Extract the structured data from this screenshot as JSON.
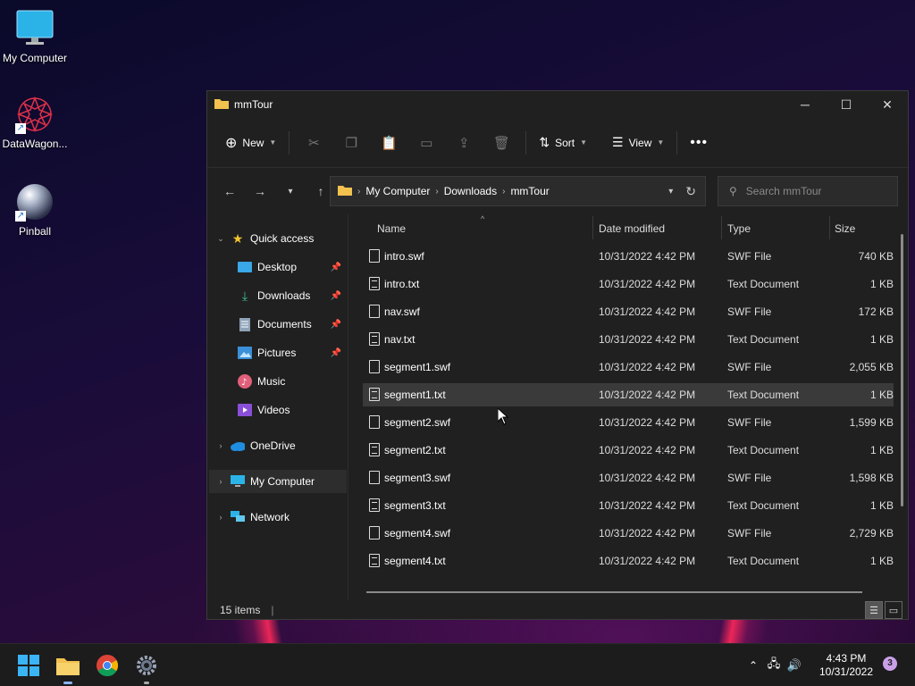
{
  "desktop": {
    "icons": [
      {
        "label": "My Computer"
      },
      {
        "label": "DataWagon..."
      },
      {
        "label": "Pinball"
      }
    ]
  },
  "window": {
    "title": "mmTour",
    "toolbar": {
      "new_label": "New",
      "sort_label": "Sort",
      "view_label": "View"
    },
    "breadcrumb": [
      "My Computer",
      "Downloads",
      "mmTour"
    ],
    "search_placeholder": "Search mmTour",
    "sidebar": {
      "quick_access": "Quick access",
      "items": [
        {
          "label": "Desktop"
        },
        {
          "label": "Downloads"
        },
        {
          "label": "Documents"
        },
        {
          "label": "Pictures"
        },
        {
          "label": "Music"
        },
        {
          "label": "Videos"
        }
      ],
      "onedrive": "OneDrive",
      "my_computer": "My Computer",
      "network": "Network"
    },
    "columns": {
      "name": "Name",
      "date": "Date modified",
      "type": "Type",
      "size": "Size"
    },
    "files": [
      {
        "name": "intro.swf",
        "date": "10/31/2022 4:42 PM",
        "type": "SWF File",
        "size": "740 KB"
      },
      {
        "name": "intro.txt",
        "date": "10/31/2022 4:42 PM",
        "type": "Text Document",
        "size": "1 KB"
      },
      {
        "name": "nav.swf",
        "date": "10/31/2022 4:42 PM",
        "type": "SWF File",
        "size": "172 KB"
      },
      {
        "name": "nav.txt",
        "date": "10/31/2022 4:42 PM",
        "type": "Text Document",
        "size": "1 KB"
      },
      {
        "name": "segment1.swf",
        "date": "10/31/2022 4:42 PM",
        "type": "SWF File",
        "size": "2,055 KB"
      },
      {
        "name": "segment1.txt",
        "date": "10/31/2022 4:42 PM",
        "type": "Text Document",
        "size": "1 KB"
      },
      {
        "name": "segment2.swf",
        "date": "10/31/2022 4:42 PM",
        "type": "SWF File",
        "size": "1,599 KB"
      },
      {
        "name": "segment2.txt",
        "date": "10/31/2022 4:42 PM",
        "type": "Text Document",
        "size": "1 KB"
      },
      {
        "name": "segment3.swf",
        "date": "10/31/2022 4:42 PM",
        "type": "SWF File",
        "size": "1,598 KB"
      },
      {
        "name": "segment3.txt",
        "date": "10/31/2022 4:42 PM",
        "type": "Text Document",
        "size": "1 KB"
      },
      {
        "name": "segment4.swf",
        "date": "10/31/2022 4:42 PM",
        "type": "SWF File",
        "size": "2,729 KB"
      },
      {
        "name": "segment4.txt",
        "date": "10/31/2022 4:42 PM",
        "type": "Text Document",
        "size": "1 KB"
      }
    ],
    "status": "15 items"
  },
  "taskbar": {
    "time": "4:43 PM",
    "date": "10/31/2022",
    "notifications": "3"
  },
  "colors": {
    "accent": "#0078d4",
    "folder": "#f2c14e",
    "selection": "#3a3a3a"
  }
}
